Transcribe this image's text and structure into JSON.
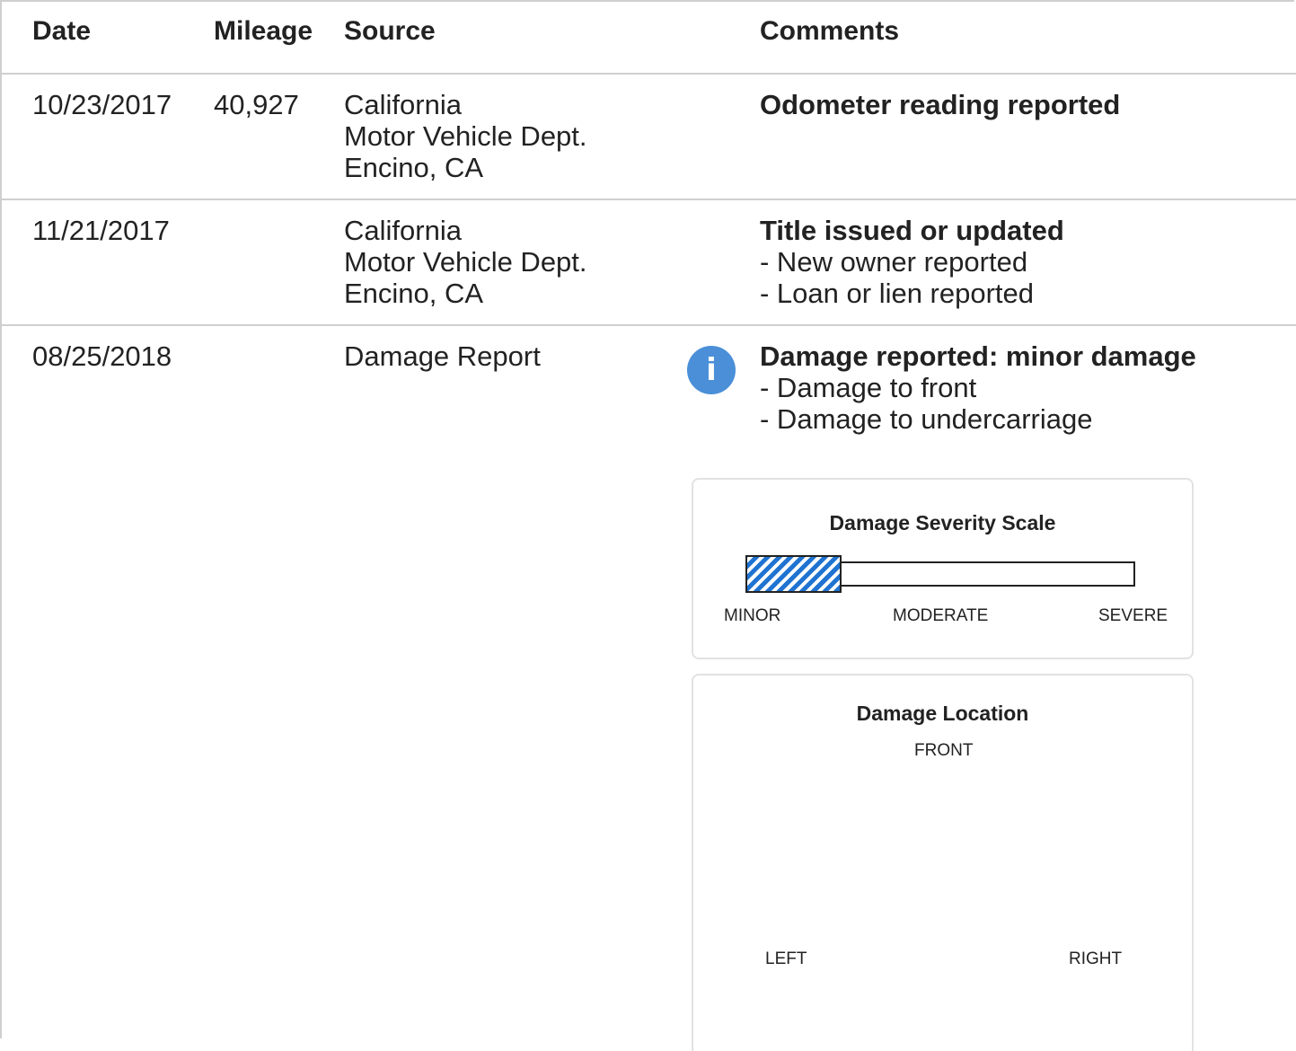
{
  "table": {
    "headers": {
      "date": "Date",
      "mileage": "Mileage",
      "source": "Source",
      "comments": "Comments"
    },
    "rows": [
      {
        "date": "10/23/2017",
        "mileage": "40,927",
        "source": [
          "California",
          "Motor Vehicle Dept.",
          "Encino, CA"
        ],
        "comment_title": "Odometer reading reported",
        "comment_items": []
      },
      {
        "date": "11/21/2017",
        "mileage": "",
        "source": [
          "California",
          "Motor Vehicle Dept.",
          "Encino, CA"
        ],
        "comment_title": "Title issued or updated",
        "comment_items": [
          "- New owner reported",
          "- Loan or lien reported"
        ]
      },
      {
        "date": "08/25/2018",
        "mileage": "",
        "source": [
          "Damage Report"
        ],
        "comment_title": "Damage reported: minor damage",
        "comment_items": [
          "- Damage to front",
          "- Damage to undercarriage"
        ],
        "icon": "info-icon",
        "icon_glyph": "i"
      }
    ]
  },
  "severity_scale": {
    "title": "Damage Severity Scale",
    "level_fraction": 0.24,
    "accent_color": "#1f73d1",
    "labels": {
      "minor": "MINOR",
      "moderate": "MODERATE",
      "severe": "SEVERE"
    }
  },
  "damage_location": {
    "title": "Damage Location",
    "labels": {
      "front": "FRONT",
      "left": "LEFT",
      "right": "RIGHT"
    }
  },
  "colors": {
    "info_icon": "#4a8fd8",
    "divider": "#cfcfcf"
  }
}
